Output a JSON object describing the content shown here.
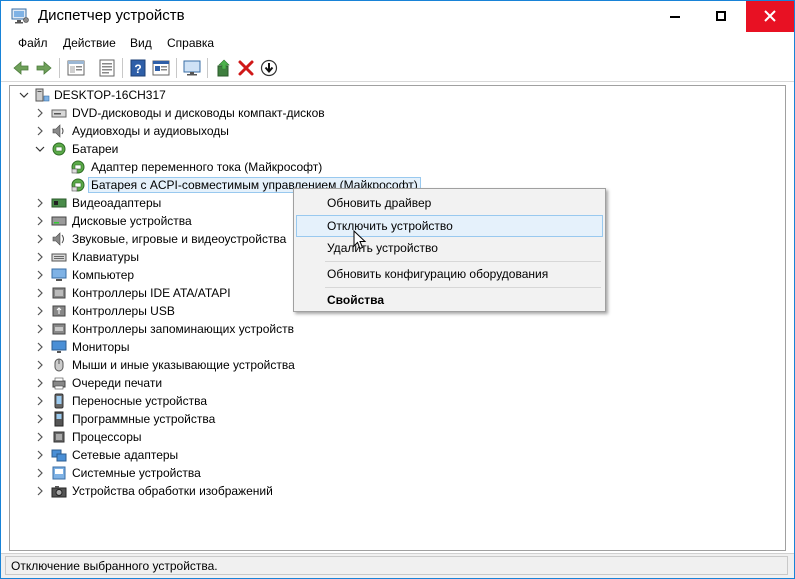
{
  "window": {
    "title": "Диспетчер устройств"
  },
  "menu": {
    "file": "Файл",
    "action": "Действие",
    "view": "Вид",
    "help": "Справка"
  },
  "toolbar_icons": [
    "back-arrow-icon",
    "forward-arrow-icon",
    "properties-icon",
    "update-icon",
    "help-icon",
    "details-icon",
    "monitor-scan-icon",
    "add-driver-icon",
    "remove-icon",
    "download-icon"
  ],
  "tree": {
    "root": "DESKTOP-16CH317",
    "items": [
      {
        "label": "DVD-дисководы и дисководы компакт-дисков",
        "icon": "dvd-drive-icon"
      },
      {
        "label": "Аудиовходы и аудиовыходы",
        "icon": "speaker-icon"
      },
      {
        "label": "Батареи",
        "icon": "battery-icon",
        "expanded": true,
        "children": [
          {
            "label": "Адаптер переменного тока (Майкрософт)",
            "icon": "battery-device-icon"
          },
          {
            "label": "Батарея с ACPI-совместимым управлением (Майкрософт)",
            "icon": "battery-device-icon",
            "selected": true
          }
        ]
      },
      {
        "label": "Видеоадаптеры",
        "icon": "display-adapter-icon"
      },
      {
        "label": "Дисковые устройства",
        "icon": "disk-drive-icon"
      },
      {
        "label": "Звуковые, игровые и видеоустройства",
        "icon": "sound-device-icon"
      },
      {
        "label": "Клавиатуры",
        "icon": "keyboard-icon"
      },
      {
        "label": "Компьютер",
        "icon": "computer-icon"
      },
      {
        "label": "Контроллеры IDE ATA/ATAPI",
        "icon": "ide-controller-icon"
      },
      {
        "label": "Контроллеры USB",
        "icon": "usb-icon"
      },
      {
        "label": "Контроллеры запоминающих устройств",
        "icon": "storage-controller-icon"
      },
      {
        "label": "Мониторы",
        "icon": "monitor-icon"
      },
      {
        "label": "Мыши и иные указывающие устройства",
        "icon": "mouse-icon"
      },
      {
        "label": "Очереди печати",
        "icon": "printer-icon"
      },
      {
        "label": "Переносные устройства",
        "icon": "portable-device-icon"
      },
      {
        "label": "Программные устройства",
        "icon": "software-device-icon"
      },
      {
        "label": "Процессоры",
        "icon": "processor-icon"
      },
      {
        "label": "Сетевые адаптеры",
        "icon": "network-adapter-icon"
      },
      {
        "label": "Системные устройства",
        "icon": "system-device-icon"
      },
      {
        "label": "Устройства обработки изображений",
        "icon": "camera-icon"
      }
    ]
  },
  "context_menu": {
    "items": [
      {
        "label": "Обновить драйвер"
      },
      {
        "label": "Отключить устройство",
        "hovered": true
      },
      {
        "label": "Удалить устройство"
      },
      {
        "label": "Обновить конфигурацию оборудования"
      },
      {
        "label": "Свойства",
        "bold": true
      }
    ]
  },
  "status": {
    "text": "Отключение выбранного устройства."
  },
  "colors": {
    "accent_border": "#1883d7",
    "close_red": "#e81123",
    "selection_bg": "#e5f1fb",
    "selection_border": "#99c9ef"
  }
}
